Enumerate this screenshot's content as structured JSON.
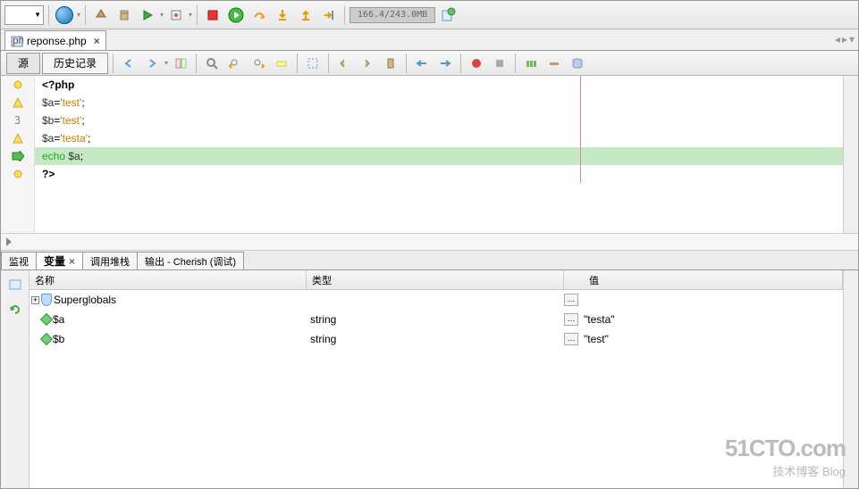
{
  "memory_indicator": "166.4/243.0MB",
  "file_tab": {
    "name": "reponse.php"
  },
  "sub_tabs": {
    "source": "源",
    "history": "历史记录"
  },
  "code": {
    "l1": "<?php",
    "l2_var": "$a",
    "l2_eq": "=",
    "l2_str": "'test'",
    "l2_end": ";",
    "l3_var": "$b",
    "l3_eq": "=",
    "l3_str": "'test'",
    "l3_end": ";",
    "l4_var": "$a",
    "l4_eq": "=",
    "l4_str": "'testa'",
    "l4_end": ";",
    "l5_kw": "echo ",
    "l5_var": "$a",
    "l5_end": ";",
    "l6": "?>",
    "line_no_3": "3"
  },
  "panel_tabs": {
    "watch": "监视",
    "variables": "变量",
    "callstack": "调用堆栈",
    "output": "输出 - Cherish (调试)"
  },
  "var_table": {
    "head_name": "名称",
    "head_type": "类型",
    "head_value": "值",
    "rows": [
      {
        "name": "Superglobals",
        "type": "",
        "value": "",
        "icon": "shield",
        "expandable": true
      },
      {
        "name": "$a",
        "type": "string",
        "value": "\"testa\"",
        "icon": "diamond",
        "expandable": false
      },
      {
        "name": "$b",
        "type": "string",
        "value": "\"test\"",
        "icon": "diamond",
        "expandable": false
      }
    ]
  },
  "watermark": {
    "line1": "51CTO.com",
    "line2": "技术博客   Blog"
  }
}
